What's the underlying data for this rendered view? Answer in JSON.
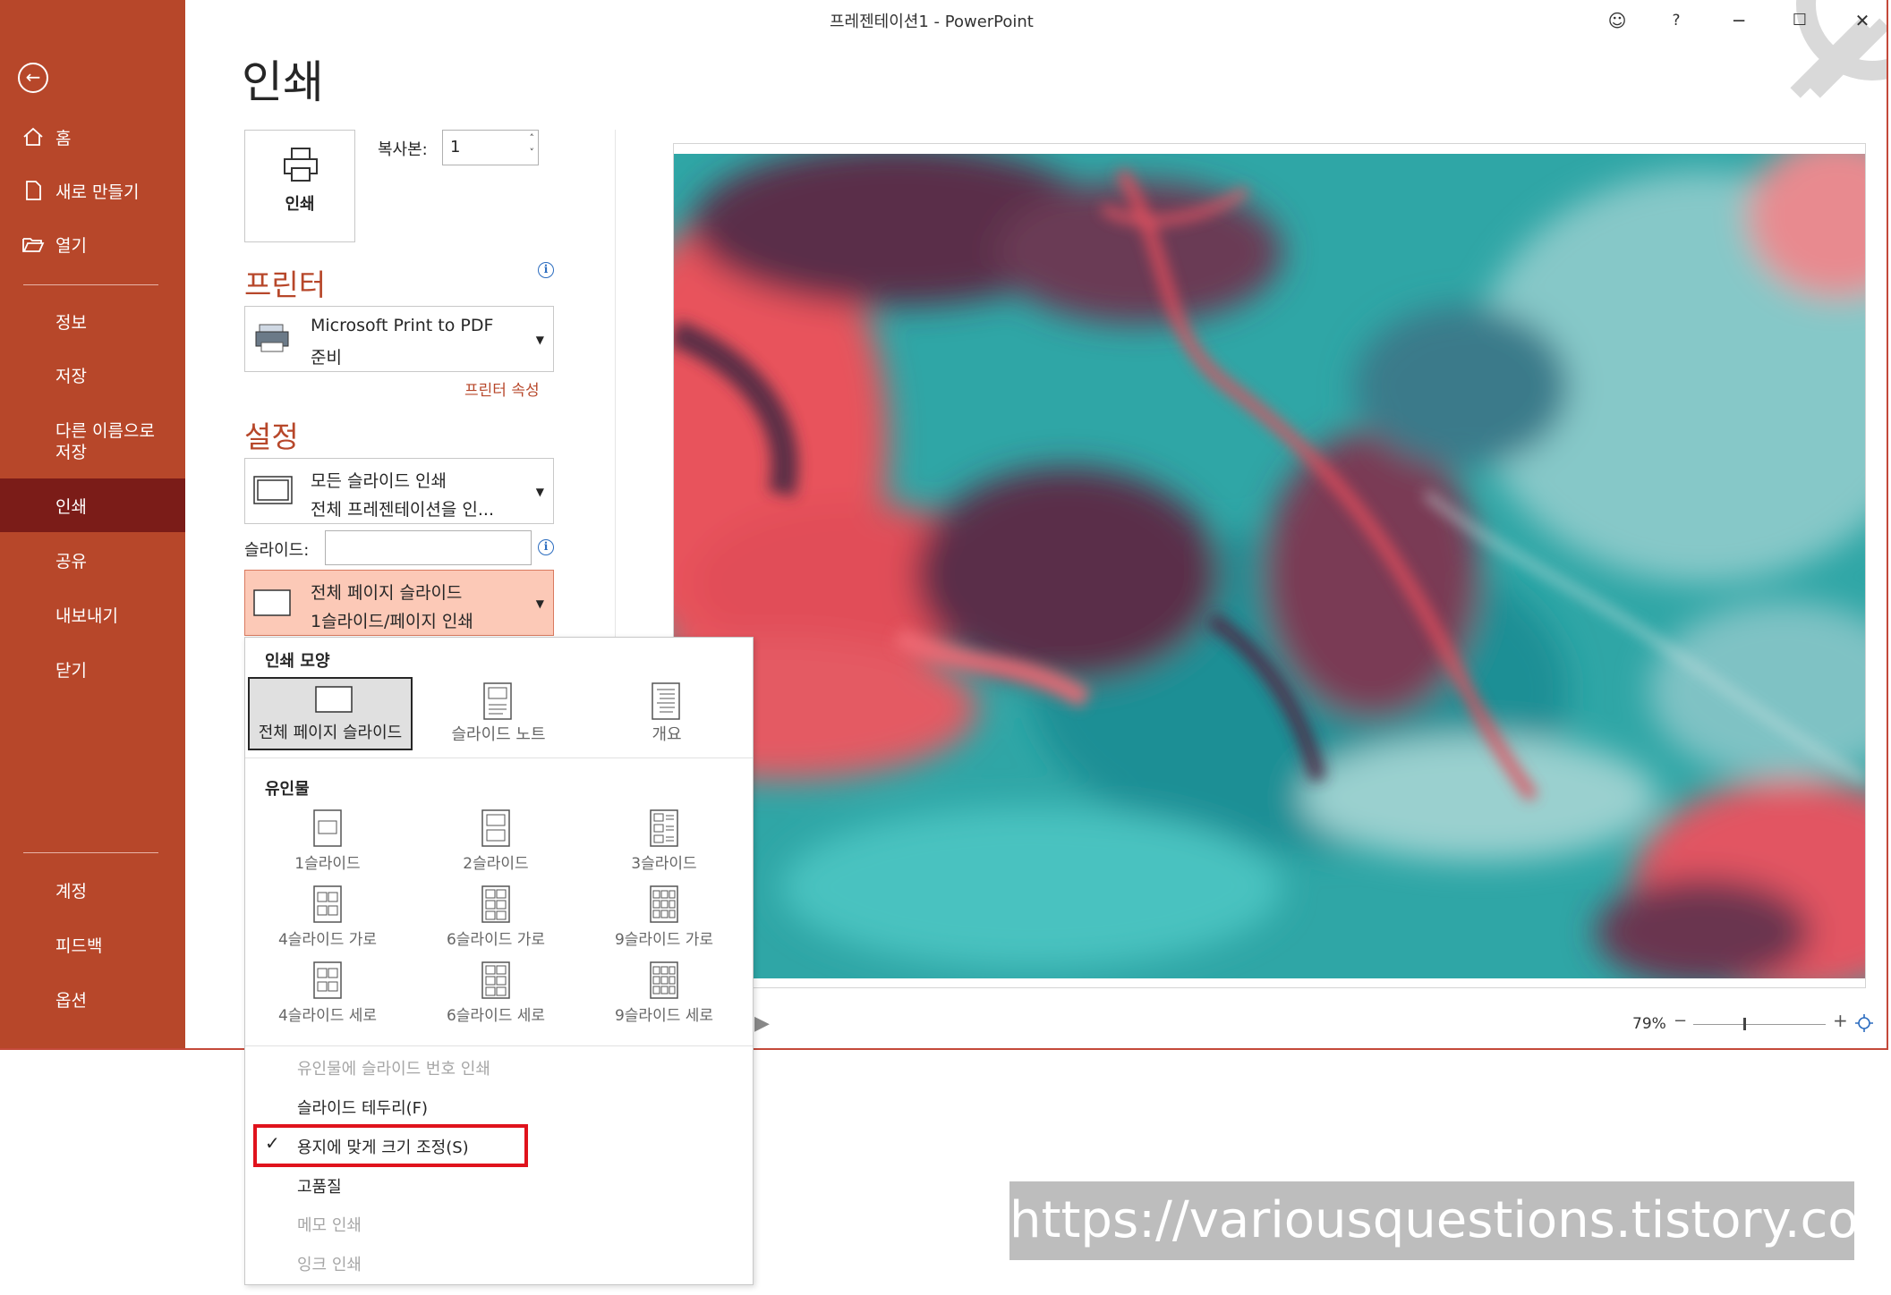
{
  "window": {
    "title": "프레젠테이션1 - PowerPoint"
  },
  "sidebar": {
    "items": [
      {
        "label": "홈"
      },
      {
        "label": "새로 만들기"
      },
      {
        "label": "열기"
      },
      {
        "label": "정보"
      },
      {
        "label": "저장"
      },
      {
        "label": "다른 이름으로 저장"
      },
      {
        "label": "인쇄",
        "active": true
      },
      {
        "label": "공유"
      },
      {
        "label": "내보내기"
      },
      {
        "label": "닫기"
      },
      {
        "label": "계정"
      },
      {
        "label": "피드백"
      },
      {
        "label": "옵션"
      }
    ]
  },
  "page": {
    "title": "인쇄"
  },
  "print": {
    "button_label": "인쇄",
    "copies_label": "복사본:",
    "copies_value": "1"
  },
  "printer": {
    "heading": "프린터",
    "name": "Microsoft Print to PDF",
    "status": "준비",
    "properties_link": "프린터 속성"
  },
  "settings": {
    "heading": "설정",
    "range": {
      "line1": "모든 슬라이드 인쇄",
      "line2": "전체 프레젠테이션을 인..."
    },
    "slides_label": "슬라이드:",
    "slides_value": "",
    "layout": {
      "line1": "전체 페이지 슬라이드",
      "line2": "1슬라이드/페이지 인쇄"
    }
  },
  "menu": {
    "print_layout_heading": "인쇄 모양",
    "layouts": [
      {
        "label": "전체 페이지 슬라이드",
        "selected": true
      },
      {
        "label": "슬라이드 노트"
      },
      {
        "label": "개요"
      }
    ],
    "handouts_heading": "유인물",
    "handouts": [
      {
        "label": "1슬라이드"
      },
      {
        "label": "2슬라이드"
      },
      {
        "label": "3슬라이드"
      },
      {
        "label": "4슬라이드 가로"
      },
      {
        "label": "6슬라이드 가로"
      },
      {
        "label": "9슬라이드 가로"
      },
      {
        "label": "4슬라이드 세로"
      },
      {
        "label": "6슬라이드 세로"
      },
      {
        "label": "9슬라이드 세로"
      }
    ],
    "options": [
      {
        "label": "유인물에 슬라이드 번호 인쇄",
        "disabled": true
      },
      {
        "label": "슬라이드 테두리(F)"
      },
      {
        "label": "용지에 맞게 크기 조정(S)",
        "checked": true
      },
      {
        "label": "고품질"
      },
      {
        "label": "메모 인쇄",
        "disabled": true
      },
      {
        "label": "잉크 인쇄",
        "disabled": true
      }
    ]
  },
  "preview": {
    "zoom": "79%"
  },
  "watermark": {
    "text": "https://variousquestions.tistory.com"
  },
  "colors": {
    "accent": "#b7472a",
    "active_nav": "#7b1c18",
    "highlight": "#fcc9b7",
    "annotation": "#e0121c"
  }
}
